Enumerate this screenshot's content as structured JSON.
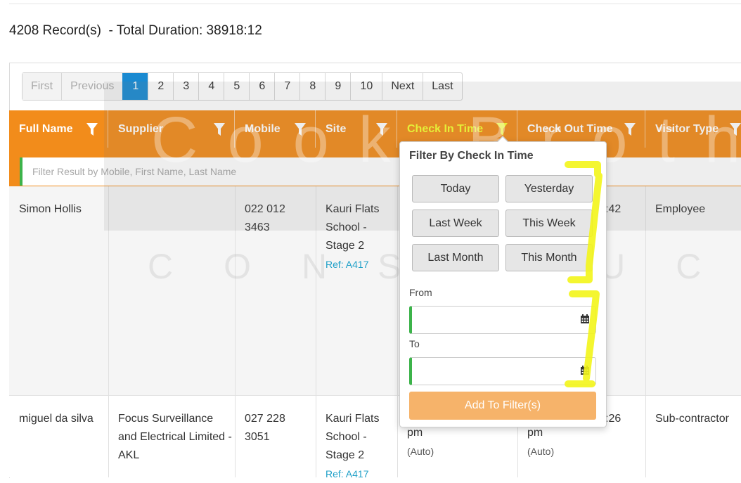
{
  "summary": {
    "count_text": "4208 Record(s)",
    "duration_text": "  - Total Duration: 38918:12"
  },
  "pagination": {
    "first": "First",
    "previous": "Previous",
    "pages": [
      "1",
      "2",
      "3",
      "4",
      "5",
      "6",
      "7",
      "8",
      "9",
      "10"
    ],
    "active_page": "1",
    "next": "Next",
    "last": "Last"
  },
  "table": {
    "columns": [
      "Full Name",
      "Supplier",
      "Mobile",
      "Site",
      "Check In Time",
      "Check Out Time",
      "Visitor Type"
    ],
    "active_column": "Check In Time",
    "filter_placeholder": "Filter Result by Mobile, First Name, Last Name",
    "rows": [
      {
        "full_name": "Simon Hollis",
        "supplier": "",
        "mobile": "022 012 3463",
        "site": "Kauri Flats School - Stage 2",
        "site_ref": "Ref: A417",
        "check_out_partial": ":42",
        "visitor_type": "Employee"
      },
      {
        "full_name": "miguel da silva",
        "supplier": "Focus Surveillance and Electrical Limited - AKL",
        "mobile": "027 228 3051",
        "site": "Kauri Flats School - Stage 2",
        "site_ref": "Ref: A417",
        "check_in_partial": "pm",
        "check_in_auto": "(Auto)",
        "check_out_partial": ":26",
        "check_out_pm": "pm",
        "check_out_auto": "(Auto)",
        "visitor_type": "Sub-contractor"
      }
    ]
  },
  "filter_popup": {
    "title": "Filter By Check In Time",
    "quick": [
      "Today",
      "Yesterday",
      "Last Week",
      "This Week",
      "Last Month",
      "This Month"
    ],
    "from_label": "From",
    "to_label": "To",
    "from_value": "",
    "to_value": "",
    "add_button": "Add To Filter(s)"
  },
  "watermark": {
    "line1": "Cook Brothers",
    "line2": "CONSTRUCTION"
  },
  "colors": {
    "header": "#f28c1b",
    "active_page": "#1a8ad1",
    "highlight_text": "#f5ff2e",
    "input_accent": "#3cb34a",
    "add_button": "#f6b36a",
    "annotation": "#f3f51a"
  },
  "icons": [
    "funnel-icon",
    "calendar-icon"
  ]
}
